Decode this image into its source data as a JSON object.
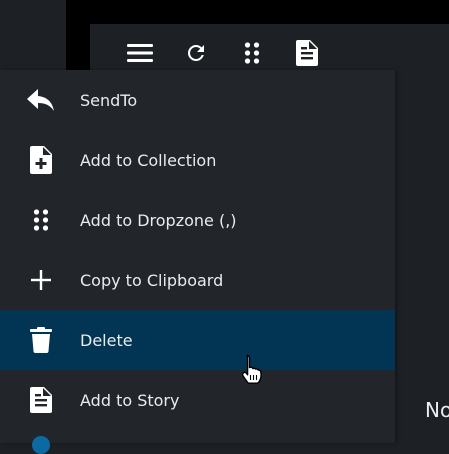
{
  "toolbar": {
    "icons": [
      "menu-icon",
      "refresh-icon",
      "dropzone-dots-icon",
      "story-document-icon"
    ]
  },
  "menu": {
    "items": [
      {
        "label": "SendTo",
        "icon": "reply-arrow-icon"
      },
      {
        "label": "Add to Collection",
        "icon": "add-file-icon"
      },
      {
        "label": "Add to Dropzone (,)",
        "icon": "dropzone-dots-icon"
      },
      {
        "label": "Copy to Clipboard",
        "icon": "plus-icon"
      },
      {
        "label": "Delete",
        "icon": "trash-icon",
        "active": true
      },
      {
        "label": "Add to Story",
        "icon": "story-document-icon"
      }
    ]
  },
  "background": {
    "partial_text": "No"
  },
  "colors": {
    "active_item": "#023554",
    "panel": "#22262b",
    "page": "#1d2126",
    "icon": "#ffffff"
  }
}
